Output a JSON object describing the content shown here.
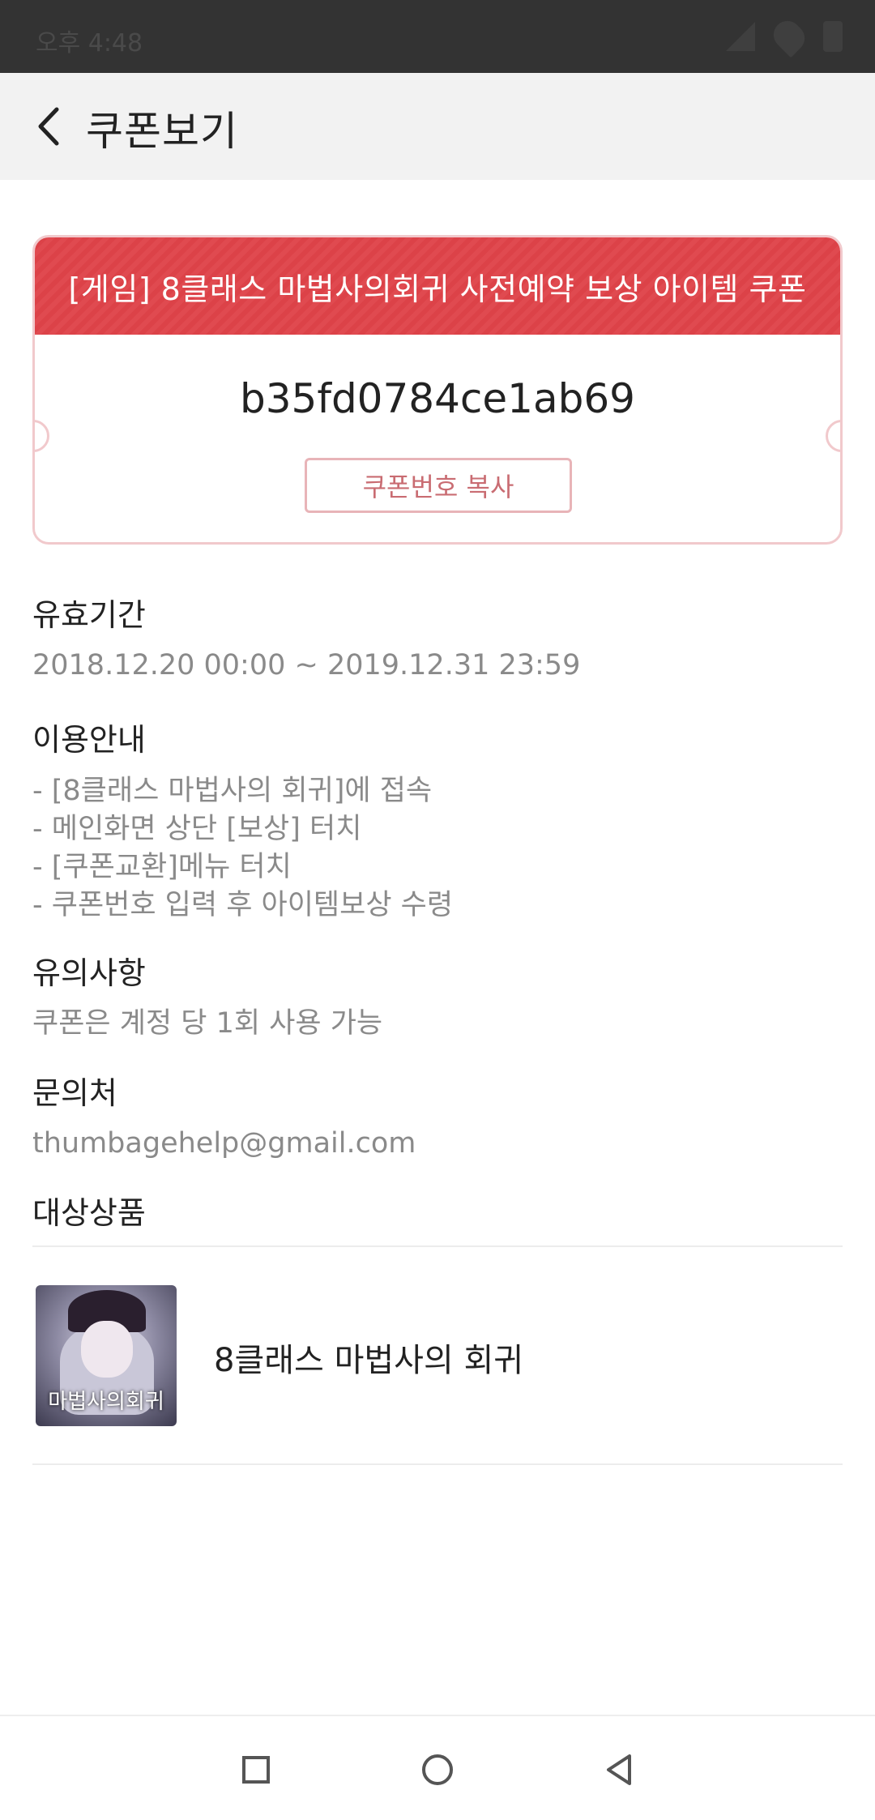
{
  "status_bar": {
    "time": "오후 4:48"
  },
  "app_bar": {
    "title": "쿠폰보기",
    "back_icon": "chevron-left-icon"
  },
  "coupon": {
    "title": "[게임] 8클래스 마법사의회귀 사전예약 보상 아이템 쿠폰",
    "code": "b35fd0784ce1ab69",
    "copy_label": "쿠폰번호 복사",
    "accent_color": "#e04a50"
  },
  "validity": {
    "title": "유효기간",
    "text": "2018.12.20 00:00 ~ 2019.12.31 23:59"
  },
  "usage": {
    "title": "이용안내",
    "lines": [
      "- [8클래스 마법사의 회귀]에 접속",
      "- 메인화면 상단 [보상] 터치",
      "- [쿠폰교환]메뉴 터치",
      "- 쿠폰번호 입력 후 아이템보상 수령"
    ]
  },
  "notice": {
    "title": "유의사항",
    "text": "쿠폰은 계정 당 1회 사용 가능"
  },
  "contact": {
    "title": "문의처",
    "text": "thumbagehelp@gmail.com"
  },
  "target_product": {
    "title": "대상상품",
    "name": "8클래스 마법사의 회귀",
    "thumb_logo": "마법사의회귀"
  },
  "nav_bar": {
    "recent_icon": "square-icon",
    "home_icon": "circle-icon",
    "back_icon": "triangle-back-icon"
  }
}
